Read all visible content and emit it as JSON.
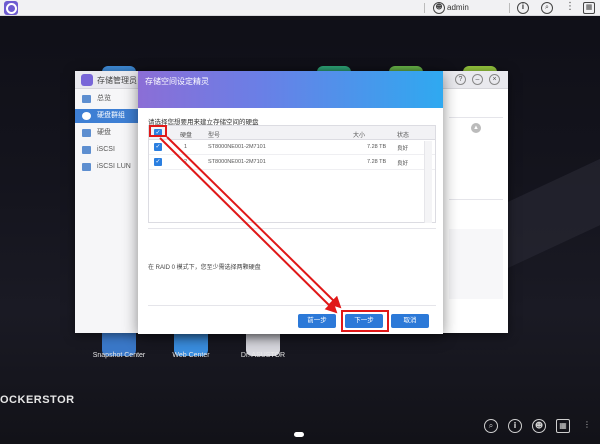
{
  "topbar": {
    "user": "admin",
    "user_icon": "user-circle-icon",
    "info_icon": "info-icon",
    "more_icon": "more-icon"
  },
  "storage_manager": {
    "title": "存储管理员",
    "sidebar": [
      {
        "label": "总览",
        "icon": "overview-icon"
      },
      {
        "label": "硬盘群组",
        "icon": "volume-icon",
        "active": true
      },
      {
        "label": "硬盘",
        "icon": "disk-icon"
      },
      {
        "label": "iSCSI",
        "icon": "iscsi-icon"
      },
      {
        "label": "iSCSI LUN",
        "icon": "lun-icon"
      }
    ]
  },
  "wizard": {
    "title": "存储空间设定精灵",
    "instruction": "请选择您想要用来建立存储空间的硬盘",
    "columns": {
      "disk": "硬盘",
      "model": "型号",
      "size": "大小",
      "status": "状态"
    },
    "rows": [
      {
        "checked": true,
        "disk": "1",
        "model": "ST8000NE001-2M7101",
        "size": "7.28 TB",
        "status": "良好"
      },
      {
        "checked": true,
        "disk": "2",
        "model": "ST8000NE001-2M7101",
        "size": "7.28 TB",
        "status": "良好"
      }
    ],
    "note": "在 RAID 0 模式下，您至少需选择两颗硬盘",
    "buttons": {
      "prev": "前一步",
      "next": "下一步",
      "cancel": "取消"
    }
  },
  "desktop": {
    "apps": [
      {
        "label": "Snapshot Center",
        "color": "#3a78c8"
      },
      {
        "label": "Web Center",
        "color": "#3a8ee0"
      },
      {
        "label": "Dr. ASUSTOR",
        "color": "#e0e0e6"
      }
    ],
    "brand": "OCKERSTOR"
  },
  "dock": {
    "icons": [
      "search-icon",
      "info-icon",
      "user-icon",
      "apps-icon"
    ]
  },
  "colors": {
    "accent": "#2c79d8",
    "highlight": "#e01818",
    "header_start": "#8b6ed6",
    "header_end": "#2fa9f0"
  }
}
